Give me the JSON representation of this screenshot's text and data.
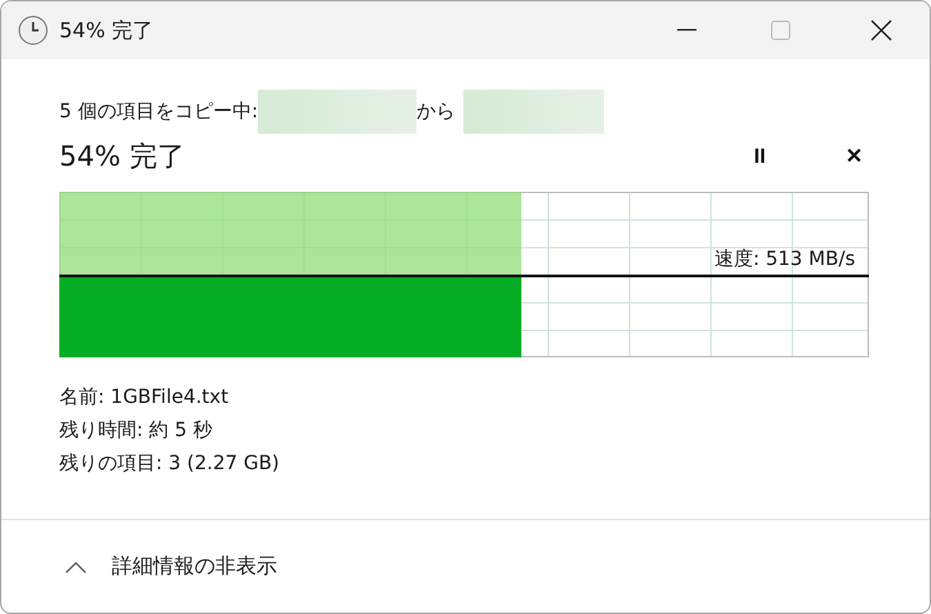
{
  "window": {
    "title": "54% 完了"
  },
  "copy": {
    "prefix": "5 個の項目をコピー中:",
    "middle": "から"
  },
  "status": {
    "title": "54% 完了",
    "pause": "II",
    "cancel": "✕"
  },
  "graph": {
    "speed": {
      "reading": "速度: 513 MB/s"
    }
  },
  "details": [
    "名前: 1GBFile4.txt",
    "残り時間: 約 5 秒",
    "残りの項目: 3 (2.27 GB)"
  ],
  "footer": {
    "label": "詳細情報の非表示",
    "expanded": true
  }
}
